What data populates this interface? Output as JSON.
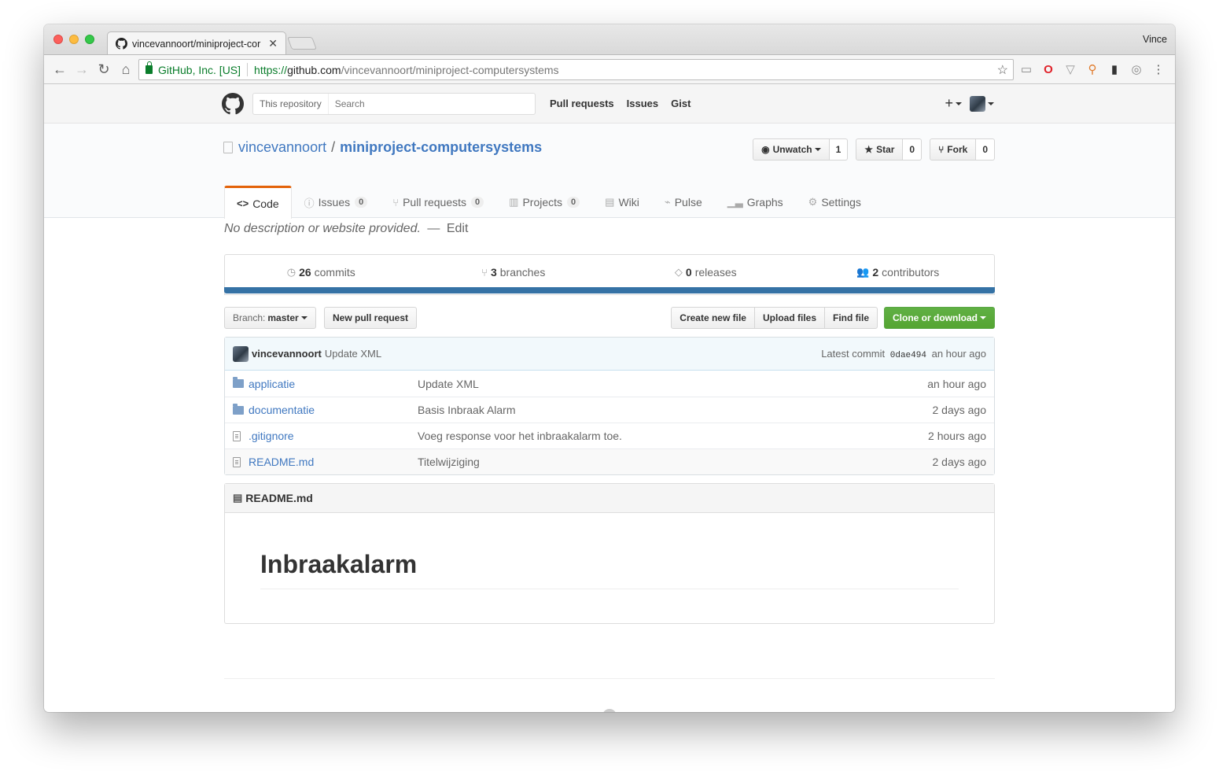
{
  "browser": {
    "tab_title": "vincevannoort/miniproject-cor",
    "profile_name": "Vince",
    "ev_label": "GitHub, Inc. [US]",
    "url_scheme": "https://",
    "url_host": "github.com",
    "url_path": "/vincevannoort/miniproject-computersystems"
  },
  "header": {
    "scope_label": "This repository",
    "search_placeholder": "Search",
    "nav": [
      "Pull requests",
      "Issues",
      "Gist"
    ],
    "plus_label": "+"
  },
  "repo": {
    "owner": "vincevannoort",
    "separator": "/",
    "name": "miniproject-computersystems",
    "watch_label": "Unwatch",
    "watch_count": "1",
    "star_label": "Star",
    "star_count": "0",
    "fork_label": "Fork",
    "fork_count": "0"
  },
  "tabs": [
    {
      "label": "Code",
      "icon": "<>",
      "counter": null
    },
    {
      "label": "Issues",
      "icon": "ⓘ",
      "counter": "0"
    },
    {
      "label": "Pull requests",
      "icon": "⑂",
      "counter": "0"
    },
    {
      "label": "Projects",
      "icon": "▥",
      "counter": "0"
    },
    {
      "label": "Wiki",
      "icon": "▤",
      "counter": null
    },
    {
      "label": "Pulse",
      "icon": "⌁",
      "counter": null
    },
    {
      "label": "Graphs",
      "icon": "▁▃",
      "counter": null
    },
    {
      "label": "Settings",
      "icon": "⚙",
      "counter": null
    }
  ],
  "description": {
    "text": "No description or website provided.",
    "dash": "—",
    "edit": "Edit"
  },
  "summary": {
    "commits_num": "26",
    "commits_label": "commits",
    "branches_num": "3",
    "branches_label": "branches",
    "releases_num": "0",
    "releases_label": "releases",
    "contributors_num": "2",
    "contributors_label": "contributors",
    "language_color": "#3572a5"
  },
  "filenav": {
    "branch_label": "Branch:",
    "branch_value": "master",
    "new_pr": "New pull request",
    "create_file": "Create new file",
    "upload_files": "Upload files",
    "find_file": "Find file",
    "clone": "Clone or download"
  },
  "commit": {
    "author": "vincevannoort",
    "message": "Update XML",
    "latest_label": "Latest commit",
    "sha": "0dae494",
    "age": "an hour ago"
  },
  "files": [
    {
      "type": "folder",
      "name": "applicatie",
      "message": "Update XML",
      "age": "an hour ago"
    },
    {
      "type": "folder",
      "name": "documentatie",
      "message": "Basis Inbraak Alarm",
      "age": "2 days ago"
    },
    {
      "type": "file",
      "name": ".gitignore",
      "message": "Voeg response voor het inbraakalarm toe.",
      "age": "2 hours ago"
    },
    {
      "type": "file",
      "name": "README.md",
      "message": "Titelwijziging",
      "age": "2 days ago"
    }
  ],
  "readme": {
    "filename": "README.md",
    "heading": "Inbraakalarm"
  }
}
